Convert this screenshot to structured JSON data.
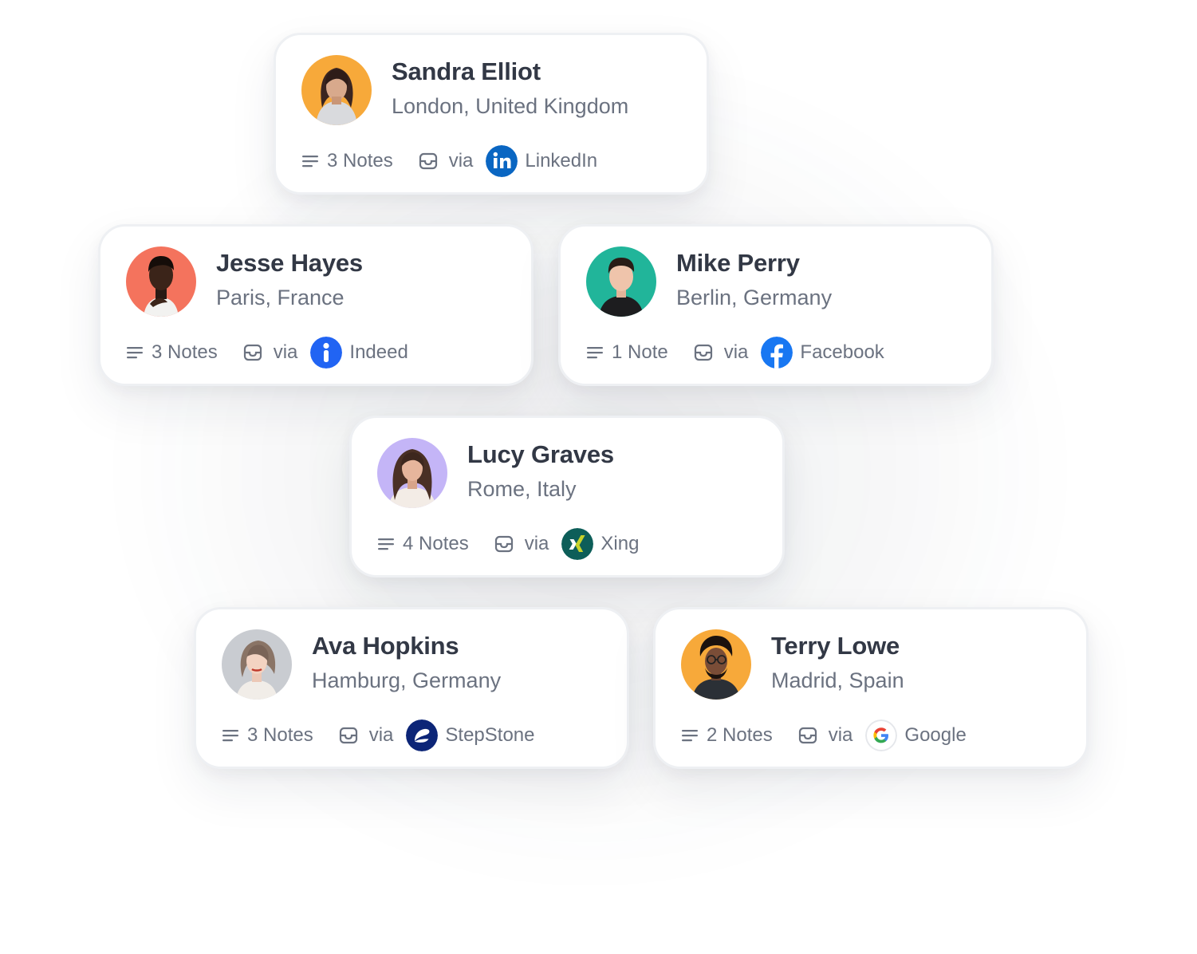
{
  "cards": [
    {
      "name": "Sandra Elliot",
      "location": "London, United Kingdom",
      "notes": "3 Notes",
      "via": "via",
      "source": "LinkedIn",
      "source_icon": "linkedin-icon",
      "avatar_bg": "#f7a93a",
      "source_color": "#0a66c2"
    },
    {
      "name": "Jesse Hayes",
      "location": "Paris, France",
      "notes": "3 Notes",
      "via": "via",
      "source": "Indeed",
      "source_icon": "indeed-icon",
      "avatar_bg": "#f4735d",
      "source_color": "#2164f3"
    },
    {
      "name": "Mike Perry",
      "location": "Berlin, Germany",
      "notes": "1 Note",
      "via": "via",
      "source": "Facebook",
      "source_icon": "facebook-icon",
      "avatar_bg": "#21b59a",
      "source_color": "#1877f2"
    },
    {
      "name": "Lucy Graves",
      "location": "Rome, Italy",
      "notes": "4 Notes",
      "via": "via",
      "source": "Xing",
      "source_icon": "xing-icon",
      "avatar_bg": "#c4b5f7",
      "source_color": "#0d5e59"
    },
    {
      "name": "Ava Hopkins",
      "location": "Hamburg, Germany",
      "notes": "3 Notes",
      "via": "via",
      "source": "StepStone",
      "source_icon": "stepstone-icon",
      "avatar_bg": "#c9ccd1",
      "source_color": "#0c2577"
    },
    {
      "name": "Terry Lowe",
      "location": "Madrid, Spain",
      "notes": "2 Notes",
      "via": "via",
      "source": "Google",
      "source_icon": "google-icon",
      "avatar_bg": "#f7a93a",
      "source_color": "#4285f4"
    }
  ]
}
